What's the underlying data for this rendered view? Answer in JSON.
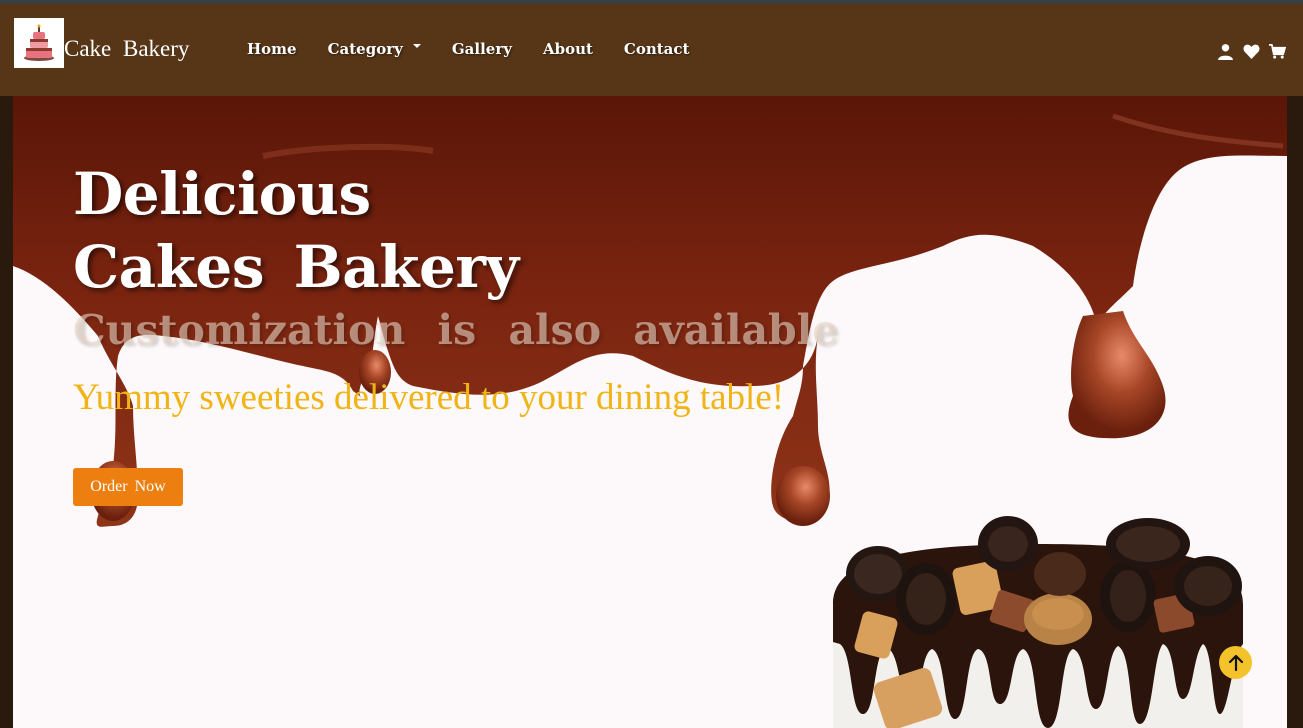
{
  "brand": {
    "name": "Cake  Bakery",
    "logo_icon": "cake-logo-icon"
  },
  "nav": {
    "items": [
      {
        "label": "Home"
      },
      {
        "label": "Category"
      },
      {
        "label": "Gallery"
      },
      {
        "label": "About"
      },
      {
        "label": "Contact"
      }
    ],
    "icons": [
      "user-icon",
      "heart-icon",
      "cart-icon"
    ]
  },
  "hero": {
    "title_line1": "Delicious",
    "title_line2": "Cakes  Bakery",
    "customization": "Customization  is  also  available",
    "tagline": "Yummy sweeties delivered to your dining table!",
    "order_button": "Order  Now"
  },
  "colors": {
    "navbar": "#573618",
    "accent_orange": "#ec7f0f",
    "tagline_yellow": "#f0b416",
    "chocolate": "#6e1e0c",
    "scroll_button": "#f4c22b"
  }
}
